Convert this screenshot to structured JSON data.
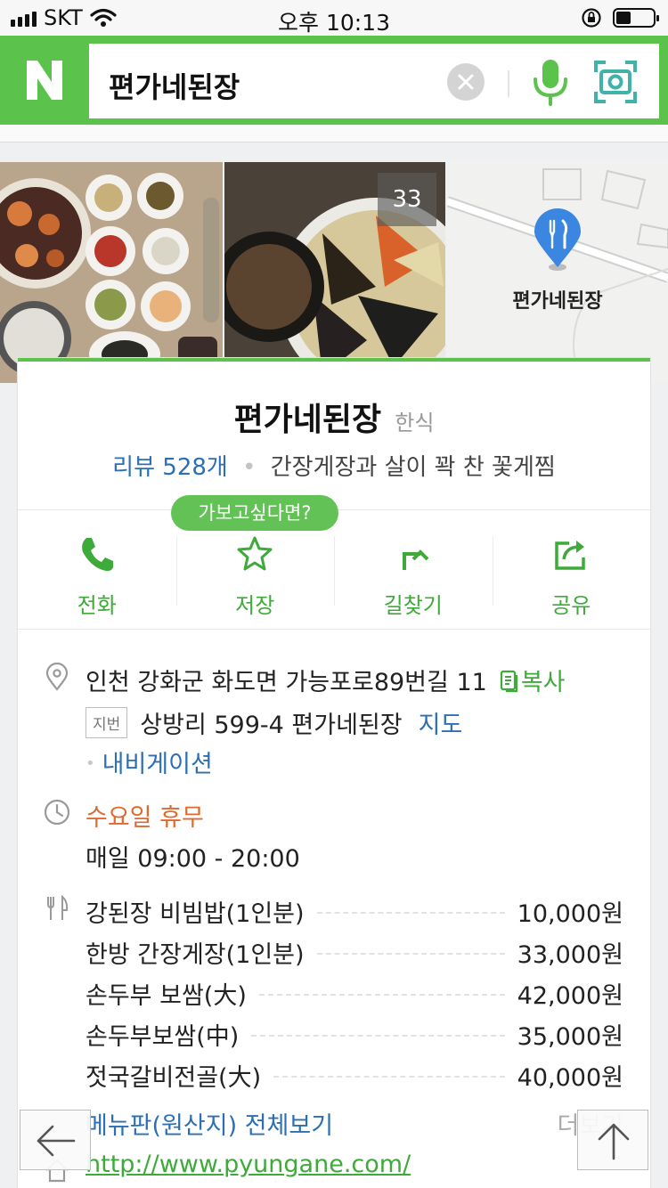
{
  "status_bar": {
    "carrier": "SKT",
    "time": "오후 10:13",
    "battery_level": 0.4
  },
  "search": {
    "logo": "N",
    "query": "편가네된장"
  },
  "photos": {
    "count_badge": "33",
    "map_label": "편가네된장"
  },
  "place": {
    "name": "편가네된장",
    "category": "한식",
    "review_link": "리뷰 528개",
    "description": "간장게장과 살이 꽉 찬 꽃게찜"
  },
  "tooltip": "가보고싶다면?",
  "actions": [
    {
      "label": "전화",
      "icon": "phone-icon"
    },
    {
      "label": "저장",
      "icon": "star-icon"
    },
    {
      "label": "길찾기",
      "icon": "directions-icon"
    },
    {
      "label": "공유",
      "icon": "share-icon"
    }
  ],
  "address": {
    "road": "인천 강화군 화도면 가능포로89번길 11",
    "copy_label": "복사",
    "jibun_tag": "지번",
    "jibun": "상방리 599-4 편가네된장",
    "map_link": "지도",
    "navigation_link": "내비게이션"
  },
  "hours": {
    "closed_day": "수요일 휴무",
    "daily": "매일 09:00 - 20:00"
  },
  "menu": [
    {
      "name": "강된장 비빔밥(1인분)",
      "price": "10,000원"
    },
    {
      "name": "한방 간장게장(1인분)",
      "price": "33,000원"
    },
    {
      "name": "손두부 보쌈(大)",
      "price": "42,000원"
    },
    {
      "name": "손두부보쌈(中)",
      "price": "35,000원"
    },
    {
      "name": "젓국갈비전골(大)",
      "price": "40,000원"
    }
  ],
  "menu_full_link": "메뉴판(원산지) 전체보기",
  "more_label": "더보기",
  "homepage": "http://www.pyungane.com/",
  "colors": {
    "brand_green": "#5bc24c",
    "link_blue": "#2c6fb5",
    "closed_orange": "#e06a2c"
  }
}
